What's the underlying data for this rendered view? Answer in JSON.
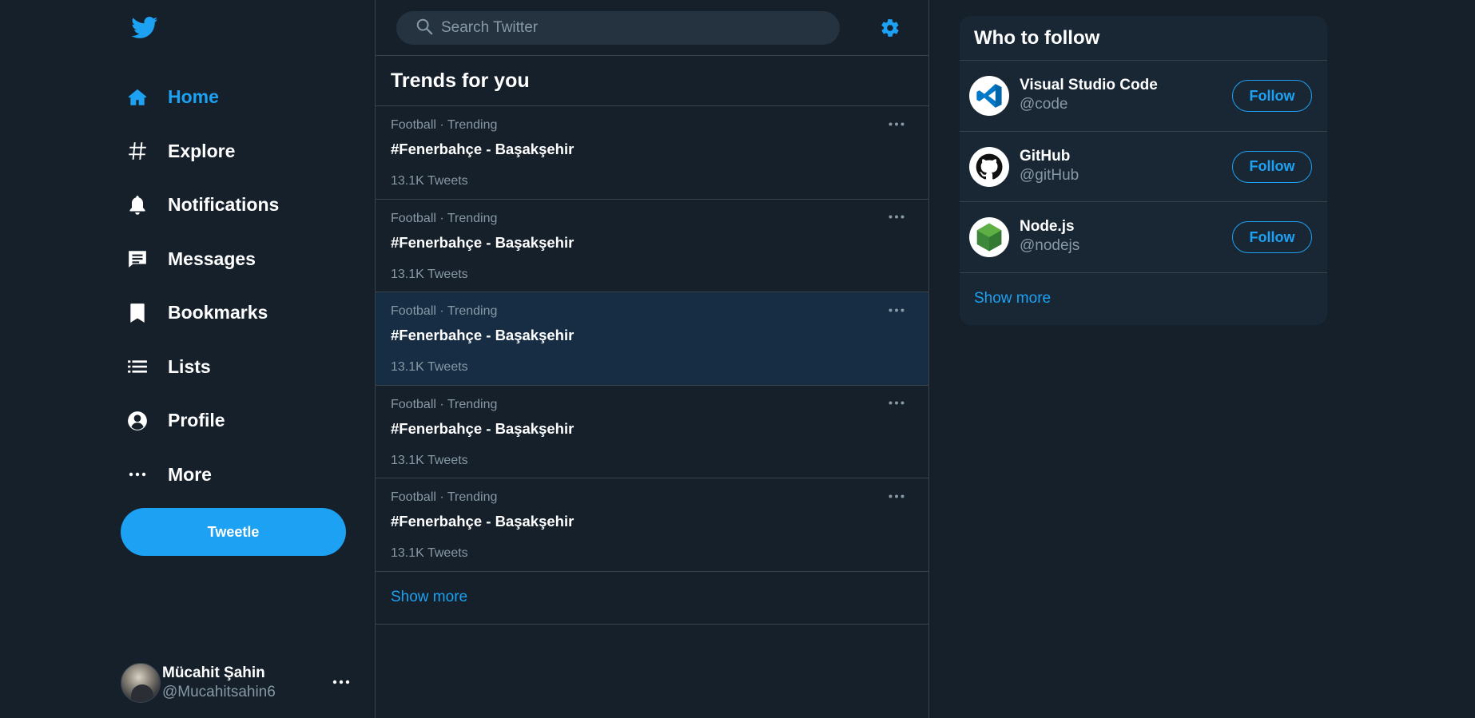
{
  "colors": {
    "background": "#15202b",
    "panel": "#192734",
    "border": "#38444d",
    "accent": "#1da1f2",
    "muted_text": "#8899a6",
    "hover_row": "#172d43"
  },
  "sidebar": {
    "logo_icon": "twitter-bird-icon",
    "items": [
      {
        "label": "Home",
        "icon": "home-icon",
        "active": true
      },
      {
        "label": "Explore",
        "icon": "hashtag-icon",
        "active": false
      },
      {
        "label": "Notifications",
        "icon": "bell-icon",
        "active": false
      },
      {
        "label": "Messages",
        "icon": "message-icon",
        "active": false
      },
      {
        "label": "Bookmarks",
        "icon": "bookmark-icon",
        "active": false
      },
      {
        "label": "Lists",
        "icon": "list-icon",
        "active": false
      },
      {
        "label": "Profile",
        "icon": "user-icon",
        "active": false
      },
      {
        "label": "More",
        "icon": "more-icon",
        "active": false
      }
    ],
    "tweet_button": "Tweetle",
    "account": {
      "name": "Mücahit Şahin",
      "handle": "@Mucahitsahin6"
    }
  },
  "search": {
    "placeholder": "Search Twitter",
    "value": ""
  },
  "trends": {
    "title": "Trends for you",
    "items": [
      {
        "meta": "Football · Trending",
        "name": "#Fenerbahçe - Başakşehir",
        "count": "13.1K Tweets",
        "hover": false
      },
      {
        "meta": "Football · Trending",
        "name": "#Fenerbahçe - Başakşehir",
        "count": "13.1K Tweets",
        "hover": false
      },
      {
        "meta": "Football · Trending",
        "name": "#Fenerbahçe - Başakşehir",
        "count": "13.1K Tweets",
        "hover": true
      },
      {
        "meta": "Football · Trending",
        "name": "#Fenerbahçe - Başakşehir",
        "count": "13.1K Tweets",
        "hover": false
      },
      {
        "meta": "Football · Trending",
        "name": "#Fenerbahçe - Başakşehir",
        "count": "13.1K Tweets",
        "hover": false
      }
    ],
    "show_more": "Show more"
  },
  "who_to_follow": {
    "title": "Who to follow",
    "items": [
      {
        "name": "Visual Studio Code",
        "handle": "@code",
        "button": "Follow",
        "avatar_icon": "vscode-logo-icon"
      },
      {
        "name": "GitHub",
        "handle": "@gitHub",
        "button": "Follow",
        "avatar_icon": "github-logo-icon"
      },
      {
        "name": "Node.js",
        "handle": "@nodejs",
        "button": "Follow",
        "avatar_icon": "nodejs-logo-icon"
      }
    ],
    "show_more": "Show more"
  }
}
